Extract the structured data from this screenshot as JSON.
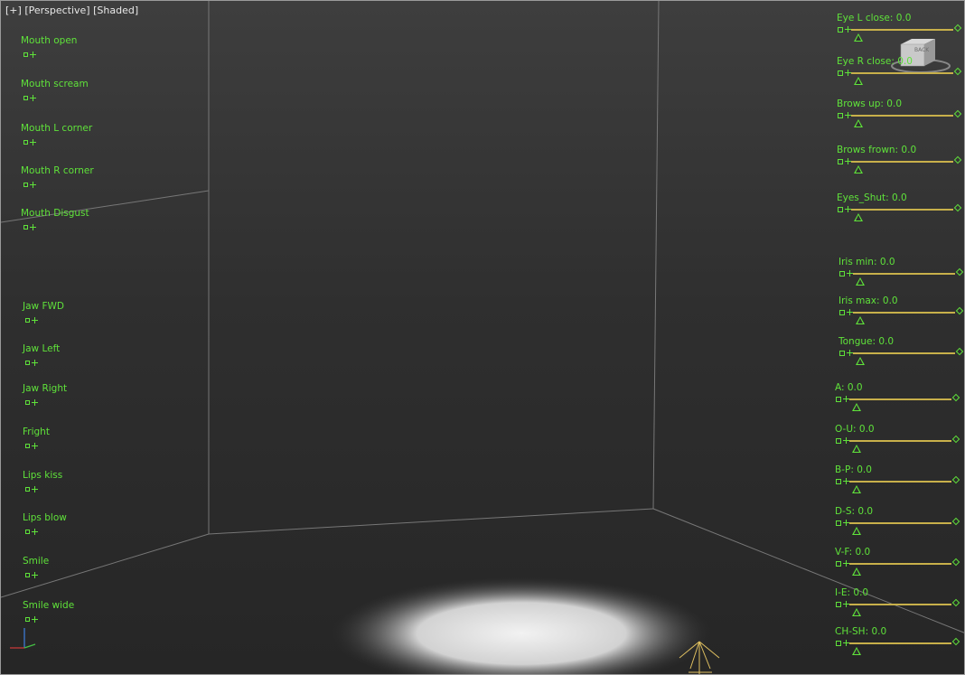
{
  "viewport": {
    "label_parts": [
      "[+]",
      "[Perspective]",
      "[Shaded]"
    ],
    "viewcube_label": "BACK"
  },
  "left_controls": [
    {
      "label": "Mouth open"
    },
    {
      "label": "Mouth scream"
    },
    {
      "label": "Mouth L corner"
    },
    {
      "label": "Mouth R corner"
    },
    {
      "label": "Mouth Disgust"
    },
    {
      "label": "Jaw FWD"
    },
    {
      "label": "Jaw Left"
    },
    {
      "label": "Jaw Right"
    },
    {
      "label": "Fright"
    },
    {
      "label": "Lips kiss"
    },
    {
      "label": "Lips blow"
    },
    {
      "label": "Smile"
    },
    {
      "label": "Smile wide"
    }
  ],
  "right_sliders": [
    {
      "label": "Eye L close: 0.0",
      "value": 0.0
    },
    {
      "label": "Eye R close: 0.0",
      "value": 0.0
    },
    {
      "label": "Brows up: 0.0",
      "value": 0.0
    },
    {
      "label": "Brows frown: 0.0",
      "value": 0.0
    },
    {
      "label": "Eyes_Shut: 0.0",
      "value": 0.0
    },
    {
      "label": "Iris min: 0.0",
      "value": 0.0
    },
    {
      "label": "Iris max: 0.0",
      "value": 0.0
    },
    {
      "label": "Tongue: 0.0",
      "value": 0.0
    },
    {
      "label": "A: 0.0",
      "value": 0.0
    },
    {
      "label": "O-U: 0.0",
      "value": 0.0
    },
    {
      "label": "B-P: 0.0",
      "value": 0.0
    },
    {
      "label": "D-S: 0.0",
      "value": 0.0
    },
    {
      "label": "V-F: 0.0",
      "value": 0.0
    },
    {
      "label": "I-E: 0.0",
      "value": 0.0
    },
    {
      "label": "CH-SH: 0.0",
      "value": 0.0
    }
  ],
  "colors": {
    "ui_green": "#5fe23a",
    "slider_track": "#c8b04a",
    "rig_blue": "#3d33c8",
    "rig_green": "#2fb82f",
    "rig_yellow": "#d6b43a",
    "rig_cyan": "#2aa6b8",
    "rig_magenta": "#c040c0"
  },
  "icons": {
    "handle": "square-plus-icon",
    "slider_thumb": "triangle-icon",
    "slider_end": "diamond-icon"
  }
}
